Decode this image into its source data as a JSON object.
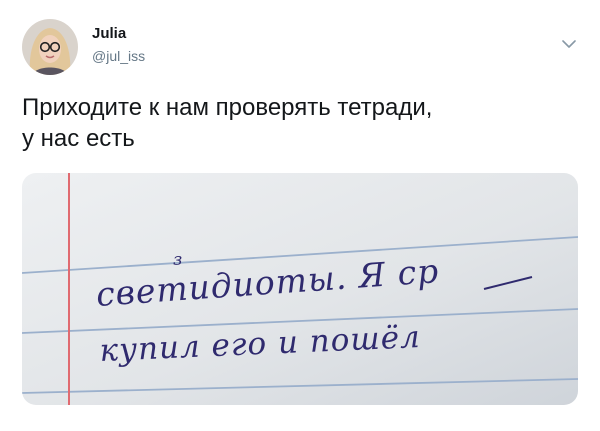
{
  "author": {
    "display_name": "Julia",
    "handle": "@jul_iss"
  },
  "tweet": {
    "text_lines": [
      "Приходите к нам проверять тетради,",
      "у нас есть"
    ]
  },
  "photo": {
    "handwriting_lines": [
      "светидиоты. Я ср",
      "купил его и пошёл"
    ],
    "correction_mark": "з"
  },
  "colors": {
    "text": "#14171a",
    "secondary": "#657786",
    "notebook_paper": "#dfe3e7",
    "notebook_lines": "#9bb0cc",
    "margin_line": "#e06a70",
    "ink": "#2f2a6e"
  },
  "icons": {
    "menu": "chevron-down-icon"
  }
}
